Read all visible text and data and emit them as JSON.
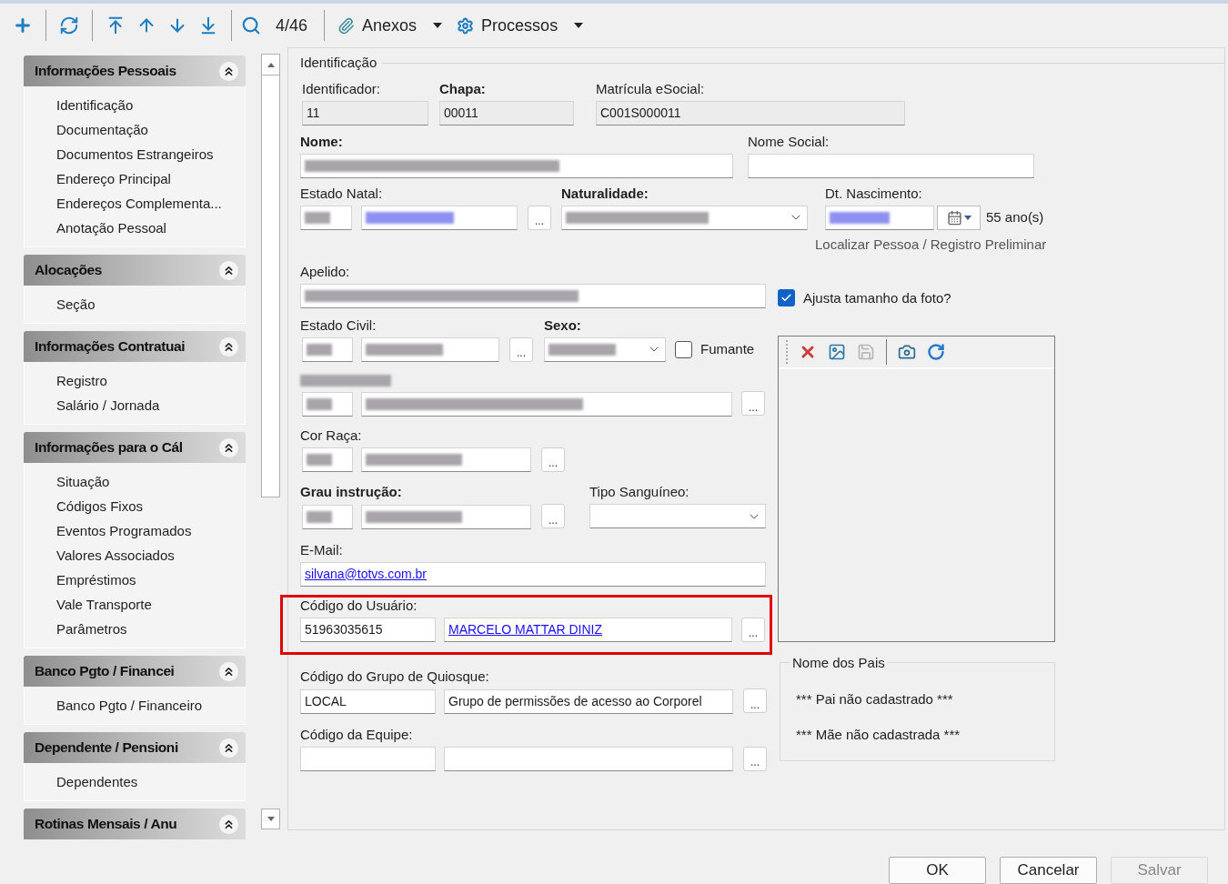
{
  "toolbar": {
    "record_counter": "4/46",
    "menus": [
      {
        "label": "Anexos"
      },
      {
        "label": "Processos"
      }
    ]
  },
  "sidebar": {
    "groups": [
      {
        "title": "Informações Pessoais",
        "expanded": true,
        "items": [
          "Identificação",
          "Documentação",
          "Documentos Estrangeiros",
          "Endereço Principal",
          "Endereços Complementa...",
          "Anotação Pessoal"
        ]
      },
      {
        "title": "Alocações",
        "expanded": true,
        "items": [
          "Seção"
        ]
      },
      {
        "title": "Informações Contratuai",
        "expanded": true,
        "items": [
          "Registro",
          "Salário / Jornada"
        ]
      },
      {
        "title": "Informações para o Cál",
        "expanded": true,
        "items": [
          "Situação",
          "Códigos Fixos",
          "Eventos Programados",
          "Valores Associados",
          "Empréstimos",
          "Vale Transporte",
          "Parâmetros"
        ]
      },
      {
        "title": "Banco Pgto / Financei",
        "expanded": true,
        "items": [
          "Banco Pgto / Financeiro"
        ]
      },
      {
        "title": "Dependente / Pensioni",
        "expanded": true,
        "items": [
          "Dependentes"
        ]
      },
      {
        "title": "Rotinas Mensais / Anu",
        "expanded": true
      }
    ]
  },
  "form": {
    "legend": "Identificação",
    "identificador": {
      "label": "Identificador:",
      "value": "11",
      "readonly": true
    },
    "chapa": {
      "label": "Chapa:",
      "required": true,
      "value": "00011",
      "readonly": true
    },
    "matricula_esocial": {
      "label": "Matrícula eSocial:",
      "value": "C001S000011",
      "readonly": true
    },
    "nome": {
      "label": "Nome:",
      "required": true,
      "redacted": true
    },
    "nome_social": {
      "label": "Nome Social:"
    },
    "estado_natal": {
      "label": "Estado Natal:",
      "code": {
        "redacted": true
      },
      "description": {
        "redacted": true,
        "link": true
      },
      "button": "..."
    },
    "naturalidade": {
      "label": "Naturalidade:",
      "required": true,
      "redacted": true
    },
    "nascimento": {
      "label": "Dt. Nascimento:",
      "redacted": true,
      "age": "55 ano(s)",
      "link": "Localizar Pessoa / Registro Preliminar"
    },
    "apelido": {
      "label": "Apelido:",
      "redacted": true
    },
    "ajusta_foto": {
      "label": "Ajusta tamanho da foto?",
      "checked": true
    },
    "estado_civil": {
      "label": "Estado Civil:",
      "code": {
        "redacted": true
      },
      "description": {
        "redacted": true
      },
      "button": "..."
    },
    "sexo": {
      "label": "Sexo:",
      "required": true,
      "redacted": true
    },
    "fumante": {
      "label": "Fumante",
      "checked": false
    },
    "nacionalidade": {
      "label_redacted": true,
      "code": {
        "redacted": true
      },
      "description": {
        "redacted": true
      },
      "button": "..."
    },
    "cor_raca": {
      "label": "Cor Raça:",
      "code": {
        "redacted": true
      },
      "description": {
        "redacted": true
      },
      "button": "..."
    },
    "grau_instrucao": {
      "label": "Grau instrução:",
      "required": true,
      "code": {
        "redacted": true
      },
      "description": {
        "redacted": true
      },
      "button": "..."
    },
    "tipo_sanguineo": {
      "label": "Tipo Sanguíneo:"
    },
    "email": {
      "label": "E-Mail:",
      "value": "silvana@totvs.com.br",
      "link": true
    },
    "codigo_usuario": {
      "label": "Código do Usuário:",
      "highlighted": true,
      "code": {
        "value": "51963035615"
      },
      "description": {
        "value": "MARCELO MATTAR DINIZ",
        "link": true
      },
      "button": "..."
    },
    "grupo_quiosque": {
      "label": "Código do Grupo de Quiosque:",
      "code": {
        "value": "LOCAL"
      },
      "description": {
        "value": "Grupo de permissões de acesso ao Corporel"
      },
      "button": "..."
    },
    "equipe": {
      "label": "Código da Equipe:",
      "button": "..."
    },
    "pais": {
      "legend": "Nome dos Pais",
      "lines": [
        "*** Pai não cadastrado ***",
        "*** Mãe não cadastrada ***"
      ]
    }
  },
  "buttons": [
    {
      "label": "OK",
      "disabled": false
    },
    {
      "label": "Cancelar",
      "disabled": false
    },
    {
      "label": "Salvar",
      "disabled": true
    }
  ]
}
